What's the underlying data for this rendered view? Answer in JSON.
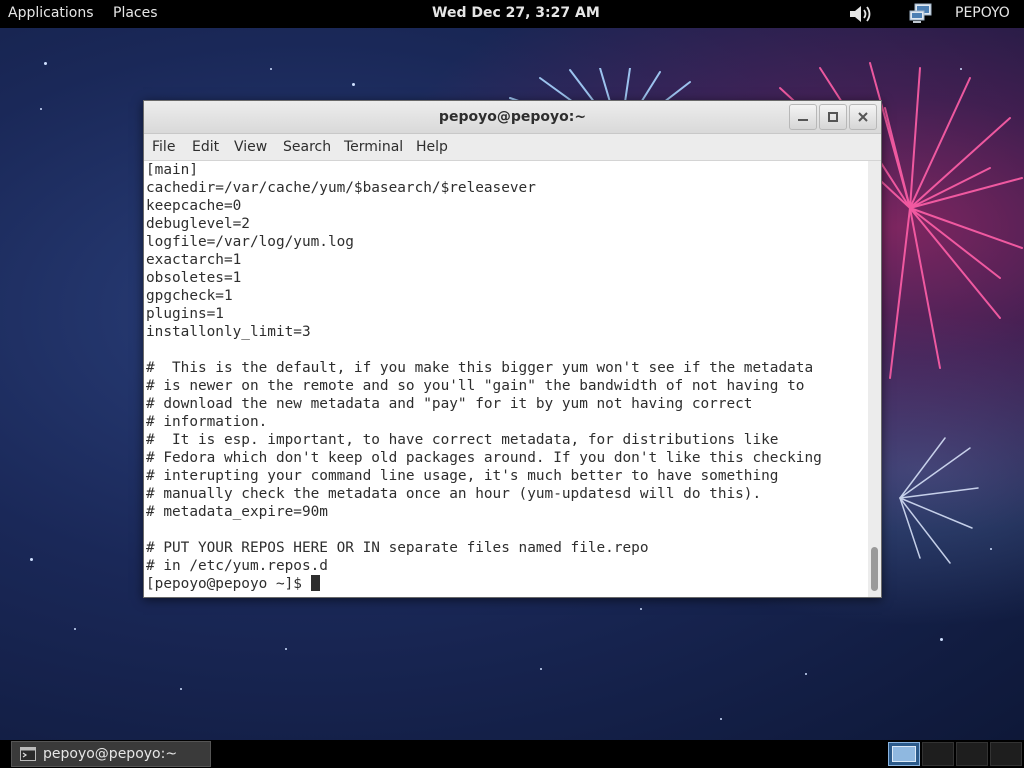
{
  "top_panel": {
    "applications": "Applications",
    "places": "Places",
    "clock": "Wed Dec 27,  3:27 AM",
    "user": "PEPOYO",
    "icons": [
      "volume-icon",
      "network-icon"
    ]
  },
  "window": {
    "title": "pepoyo@pepoyo:~",
    "menu": [
      "File",
      "Edit",
      "View",
      "Search",
      "Terminal",
      "Help"
    ],
    "terminal_lines": [
      "[main]",
      "cachedir=/var/cache/yum/$basearch/$releasever",
      "keepcache=0",
      "debuglevel=2",
      "logfile=/var/log/yum.log",
      "exactarch=1",
      "obsoletes=1",
      "gpgcheck=1",
      "plugins=1",
      "installonly_limit=3",
      "",
      "#  This is the default, if you make this bigger yum won't see if the metadata",
      "# is newer on the remote and so you'll \"gain\" the bandwidth of not having to",
      "# download the new metadata and \"pay\" for it by yum not having correct",
      "# information.",
      "#  It is esp. important, to have correct metadata, for distributions like",
      "# Fedora which don't keep old packages around. If you don't like this checking",
      "# interupting your command line usage, it's much better to have something",
      "# manually check the metadata once an hour (yum-updatesd will do this).",
      "# metadata_expire=90m",
      "",
      "# PUT YOUR REPOS HERE OR IN separate files named file.repo",
      "# in /etc/yum.repos.d"
    ],
    "prompt": "[pepoyo@pepoyo ~]$ "
  },
  "taskbar": {
    "task_label": "pepoyo@pepoyo:~"
  }
}
